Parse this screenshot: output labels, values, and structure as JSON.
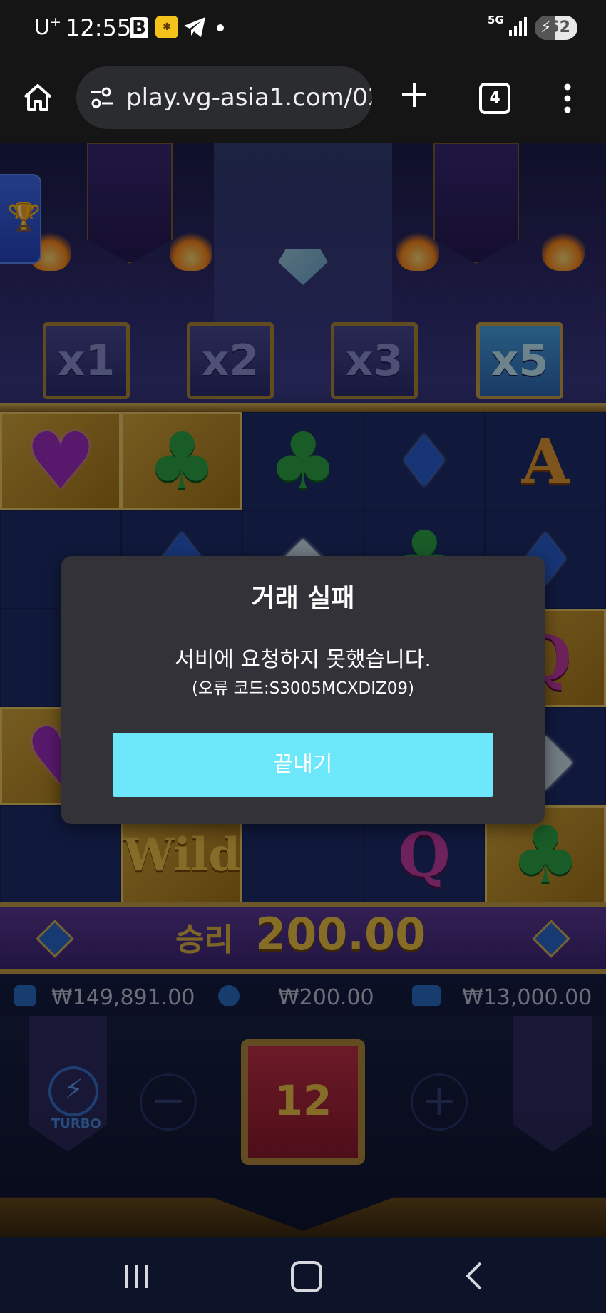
{
  "status_bar": {
    "carrier": "U",
    "carrier_sup": "+",
    "time": "12:55",
    "network": "5G",
    "battery": "52"
  },
  "browser": {
    "url": "play.vg-asia1.com/02",
    "tab_count": "4"
  },
  "game": {
    "multipliers": [
      "x1",
      "x2",
      "x3",
      "x5"
    ],
    "active_multiplier": "x5",
    "win_label": "승리",
    "win_value": "200.00",
    "balance": "₩149,891.00",
    "bet": "₩200.00",
    "win_total": "₩13,000.00",
    "spins_left": "12",
    "turbo_label": "TURBO",
    "wild_text": "Wild",
    "letter_a": "A",
    "letter_q": "Q",
    "minus": "−",
    "plus": "+"
  },
  "dialog": {
    "title": "거래 실패",
    "message": "서비에 요청하지 못했습니다.",
    "error_code": "(오류 코드:S3005MCXDIZ09)",
    "button_label": "끝내기"
  },
  "colors": {
    "dialog_bg": "#333238",
    "button_bg": "#6de8fb",
    "browser_bg": "#151515"
  }
}
